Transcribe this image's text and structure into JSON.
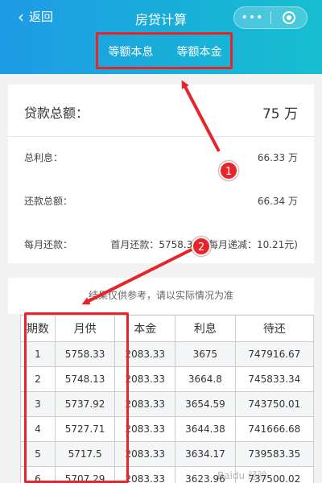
{
  "nav": {
    "back_label": "返回",
    "title": "房贷计算",
    "menu_glyph": "•••"
  },
  "tabs": [
    {
      "label": "等额本息",
      "active": false
    },
    {
      "label": "等额本金",
      "active": true
    }
  ],
  "summary": {
    "total_label": "贷款总额：",
    "total_value": "75 万",
    "interest_label": "总利息：",
    "interest_value": "66.33 万",
    "repay_label": "还款总额：",
    "repay_value": "66.34 万",
    "monthly_label": "每月还款：",
    "monthly_value": "首月还款：5758.33（每月递减：10.21元)"
  },
  "notice": "结果仅供参考，请以实际情况为准",
  "table": {
    "headers": [
      "期数",
      "月供",
      "本金",
      "利息",
      "待还"
    ],
    "rows": [
      [
        "1",
        "5758.33",
        "2083.33",
        "3675",
        "747916.67"
      ],
      [
        "2",
        "5748.13",
        "2083.33",
        "3664.8",
        "745833.34"
      ],
      [
        "3",
        "5737.92",
        "2083.33",
        "3654.59",
        "743750.01"
      ],
      [
        "4",
        "5727.71",
        "2083.33",
        "3644.38",
        "741666.68"
      ],
      [
        "5",
        "5717.5",
        "2083.33",
        "3634.17",
        "739583.35"
      ],
      [
        "6",
        "5707.29",
        "2083.33",
        "3623.96",
        "737500.02"
      ]
    ]
  },
  "annotations": {
    "badge1": "1",
    "badge2": "2",
    "color": "#e8242b"
  },
  "watermark": "Baidu 经验"
}
